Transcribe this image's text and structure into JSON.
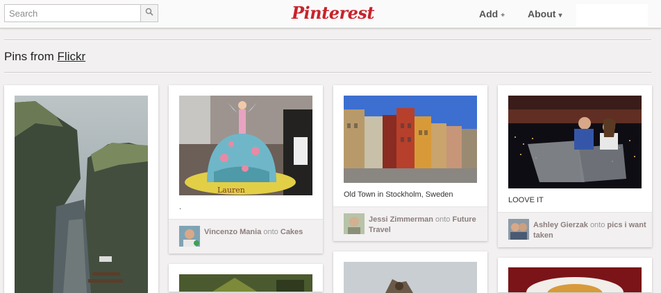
{
  "header": {
    "search": {
      "placeholder": "Search",
      "value": ""
    },
    "logo": "Pinterest",
    "add_label": "Add",
    "add_symbol": "+",
    "about_label": "About",
    "about_symbol": "▾",
    "brand_color": "#c8232c"
  },
  "page": {
    "heading_prefix": "Pins from",
    "heading_source": "Flickr"
  },
  "pins": [
    {
      "description": "",
      "user": "",
      "onto": "",
      "board": ""
    },
    {
      "description": ".",
      "user": "Vincenzo Mania",
      "onto": "onto",
      "board": "Cakes"
    },
    {
      "description": "Old Town in Stockholm, Sweden",
      "user": "Jessi Zimmerman",
      "onto": "onto",
      "board": "Future Travel"
    },
    {
      "description": "LOOVE IT",
      "user": "Ashley Gierzak",
      "onto": "onto",
      "board": "pics i want taken"
    }
  ]
}
